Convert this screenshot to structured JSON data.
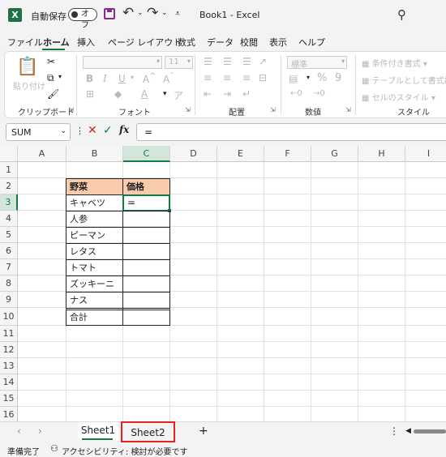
{
  "title_bar": {
    "app_icon": "X",
    "autosave_label": "自動保存",
    "autosave_state": "オフ",
    "title": "Book1  -  Excel"
  },
  "menu": [
    "ファイル",
    "ホーム",
    "挿入",
    "ページ レイアウト",
    "数式",
    "データ",
    "校閲",
    "表示",
    "ヘルプ"
  ],
  "active_menu": "ホーム",
  "ribbon": {
    "clipboard": {
      "paste_label": "貼り付け",
      "group_label": "クリップボード"
    },
    "font": {
      "size_value": "11",
      "bold": "B",
      "italic": "I",
      "underline": "U",
      "group_label": "フォント"
    },
    "alignment": {
      "group_label": "配置"
    },
    "number": {
      "format_value": "標準",
      "percent": "%",
      "comma": "9",
      "group_label": "数値"
    },
    "styles": {
      "conditional_format": "条件付き書式",
      "format_as_table": "テーブルとして書式設定",
      "cell_styles": "セルのスタイル",
      "group_label": "スタイル"
    }
  },
  "formula_bar": {
    "name_box": "SUM",
    "cancel": "✕",
    "enter": "✓",
    "fx": "fx",
    "formula": "="
  },
  "columns": [
    "A",
    "B",
    "C",
    "D",
    "E",
    "F",
    "G",
    "H",
    "I"
  ],
  "rows": [
    "1",
    "2",
    "3",
    "4",
    "5",
    "6",
    "7",
    "8",
    "9",
    "10",
    "11",
    "12",
    "13",
    "14",
    "15",
    "16"
  ],
  "active_cell": "C3",
  "table": {
    "header_item": "野菜",
    "header_price": "価格",
    "items": [
      "キャベツ",
      "人参",
      "ピーマン",
      "レタス",
      "トマト",
      "ズッキーニ",
      "ナス"
    ],
    "total_label": "合計",
    "editing_value": "=",
    "header_fill": "#f8cbad"
  },
  "sheet_tabs": [
    "Sheet1",
    "Sheet2"
  ],
  "active_sheet": "Sheet1",
  "highlighted_tab": "Sheet2",
  "status": {
    "mode": "準備完了",
    "accessibility": "アクセシビリティ: 検討が必要です"
  },
  "colors": {
    "accent": "#107c41",
    "highlight_box": "#e0231c"
  }
}
